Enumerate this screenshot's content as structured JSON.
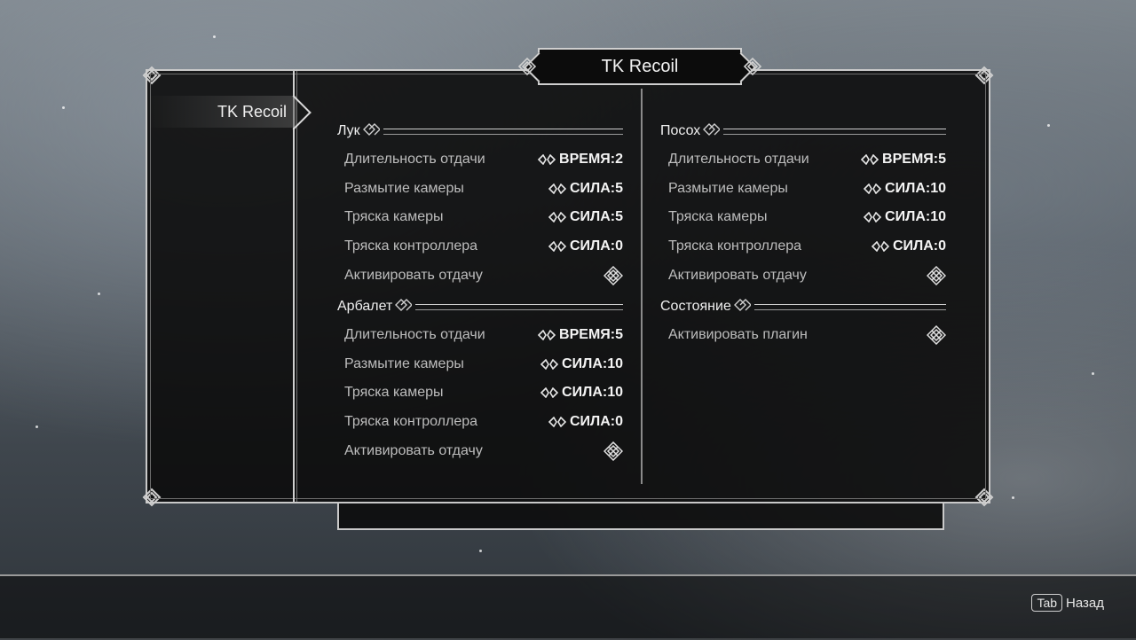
{
  "window": {
    "title": "TK Recoil"
  },
  "sidebar": {
    "items": [
      {
        "label": "TK Recoil"
      }
    ]
  },
  "left_column": {
    "sections": [
      {
        "title": "Лук",
        "rows": [
          {
            "label": "Длительность отдачи",
            "value": "ВРЕМЯ:2",
            "type": "slider"
          },
          {
            "label": "Размытие камеры",
            "value": "СИЛА:5",
            "type": "slider"
          },
          {
            "label": "Тряска камеры",
            "value": "СИЛА:5",
            "type": "slider"
          },
          {
            "label": "Тряска контроллера",
            "value": "СИЛА:0",
            "type": "slider"
          },
          {
            "label": "Активировать отдачу",
            "value": "",
            "type": "toggle"
          }
        ]
      },
      {
        "title": "Арбалет",
        "rows": [
          {
            "label": "Длительность отдачи",
            "value": "ВРЕМЯ:5",
            "type": "slider"
          },
          {
            "label": "Размытие камеры",
            "value": "СИЛА:10",
            "type": "slider"
          },
          {
            "label": "Тряска камеры",
            "value": "СИЛА:10",
            "type": "slider"
          },
          {
            "label": "Тряска контроллера",
            "value": "СИЛА:0",
            "type": "slider"
          },
          {
            "label": "Активировать отдачу",
            "value": "",
            "type": "toggle"
          }
        ]
      }
    ]
  },
  "right_column": {
    "sections": [
      {
        "title": "Посох",
        "rows": [
          {
            "label": "Длительность отдачи",
            "value": "ВРЕМЯ:5",
            "type": "slider"
          },
          {
            "label": "Размытие камеры",
            "value": "СИЛА:10",
            "type": "slider"
          },
          {
            "label": "Тряска камеры",
            "value": "СИЛА:10",
            "type": "slider"
          },
          {
            "label": "Тряска контроллера",
            "value": "СИЛА:0",
            "type": "slider"
          },
          {
            "label": "Активировать отдачу",
            "value": "",
            "type": "toggle"
          }
        ]
      },
      {
        "title": "Состояние",
        "rows": [
          {
            "label": "Активировать плагин",
            "value": "",
            "type": "toggle"
          }
        ]
      }
    ]
  },
  "footer": {
    "key": "Tab",
    "label": "Назад"
  },
  "icons": {
    "slider_arrows": "left-right-arrows-icon",
    "toggle": "knot-checkbox-icon",
    "section": "knot-ornament-icon"
  },
  "colors": {
    "panel_bg": "#0c0c0c",
    "border": "#c9c9c9",
    "label_text": "#bdbdbd",
    "value_text": "#f4f4f4"
  }
}
